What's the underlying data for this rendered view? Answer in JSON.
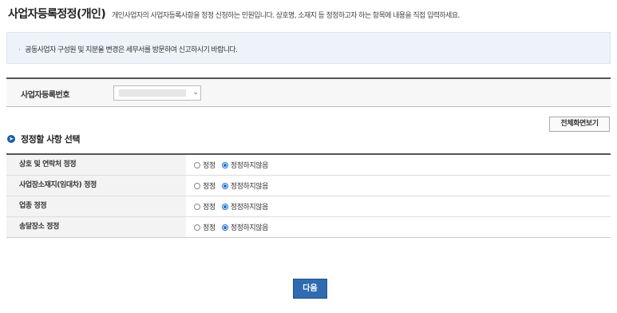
{
  "header": {
    "title": "사업자등록정정(개인)",
    "description": "개인사업자의 사업자등록사항을 정정 신청하는 민원입니다. 상호명, 소재지 등 정정하고자 하는 항목에 내용을 직접 입력하세요."
  },
  "notice": {
    "items": [
      "공동사업자 구성원 및 지분율 변경은 세무서를 방문하여 신고하시기 바랍니다."
    ]
  },
  "business_number": {
    "label": "사업자등록번호",
    "value": ""
  },
  "toolbar": {
    "fullscreen_label": "전체화면보기"
  },
  "section": {
    "title": "정정할 사항 선택"
  },
  "options": {
    "correct_label": "정정",
    "no_correct_label": "정정하지않음"
  },
  "rows": [
    {
      "label": "상호 및 연락처 정정",
      "selected": "정정하지않음"
    },
    {
      "label": "사업장소재지(임대차) 정정",
      "selected": "정정하지않음"
    },
    {
      "label": "업종 정정",
      "selected": "정정하지않음"
    },
    {
      "label": "송달장소 정정",
      "selected": "정정하지않음"
    }
  ],
  "footer": {
    "next_label": "다음"
  },
  "colors": {
    "accent": "#2f6bb0",
    "radio_selected": "#1d6fd8",
    "notice_bg": "#eef3f9"
  }
}
